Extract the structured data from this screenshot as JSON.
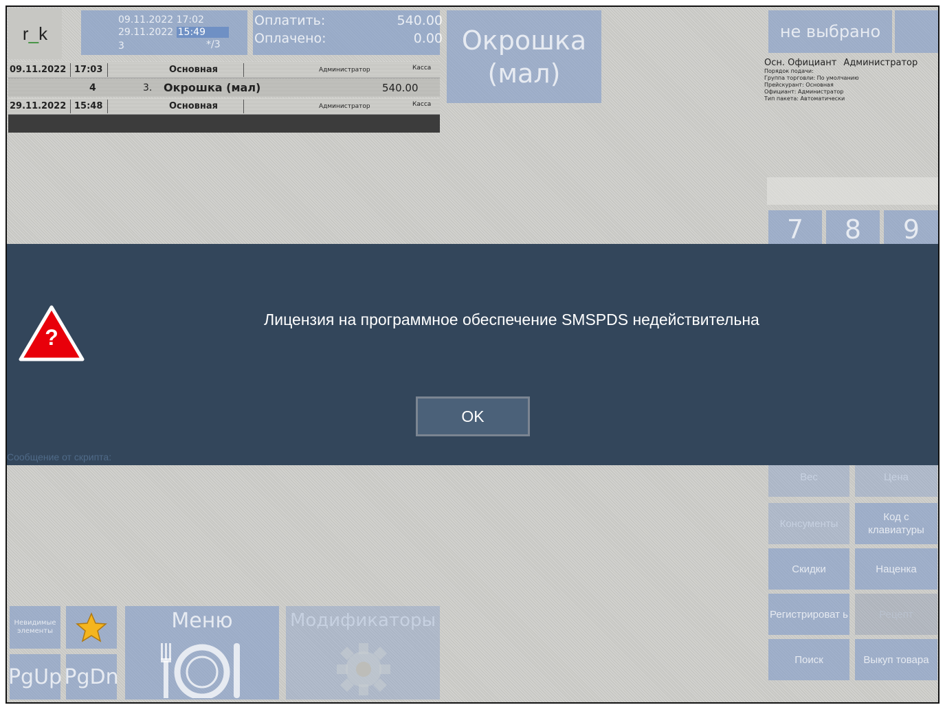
{
  "logo": {
    "text_a": "r",
    "text_b": "_",
    "text_c": "k"
  },
  "dates": {
    "date1": "09.11.2022 17:02",
    "date2_day": "29.11.2022",
    "date2_time": "15:49",
    "guests": "3",
    "table": "*/3"
  },
  "payment": {
    "to_pay_label": "Оплатить:",
    "to_pay_value": "540.00",
    "paid_label": "Оплачено:",
    "paid_value": "0.00"
  },
  "order": {
    "header1": {
      "date": "09.11.2022",
      "time": "17:03",
      "category": "Основная",
      "waiter": "Администратор",
      "station": "Касса"
    },
    "item": {
      "qty": "4",
      "num": "3.",
      "name": "Окрошка (мал)",
      "price": "540.00"
    },
    "header2": {
      "date": "29.11.2022",
      "time": "15:48",
      "category": "Основная",
      "waiter": "Администратор",
      "station": "Касса"
    }
  },
  "dish_tile": {
    "line1": "Окрошка",
    "line2": "(мал)"
  },
  "right_panel": {
    "waiter_button": "не выбрано",
    "main_waiter_label": "Осн. Официант",
    "main_waiter_value": "Администратор",
    "info_lines": [
      "Порядок подачи:",
      "Группа торговли: По умолчанию",
      "Прейскурант: Основная",
      "Официант: Администратор",
      "Тип пакета: Автоматически"
    ],
    "numpad": [
      "7",
      "8",
      "9"
    ]
  },
  "modal": {
    "message": "Лицензия на программное обеспечение SMSPDS недействительна",
    "ok_label": "OK",
    "icon_glyph": "?",
    "script_label": "Сообщение от скрипта:"
  },
  "functions": {
    "weight": "Вес",
    "price": "Цена",
    "consumables": "Консументы",
    "keyboard_code": "Код с клавиатуры",
    "discounts": "Скидки",
    "markup": "Наценка",
    "register": "Регистрироват ь",
    "recipe": "Рецепт",
    "search": "Поиск",
    "buyback": "Выкуп товара"
  },
  "bottom": {
    "invisible_elements": "Невидимые элементы",
    "pgup": "PgUp",
    "pgdn": "PgDn",
    "menu": "Меню",
    "modifiers": "Модификаторы"
  },
  "colors": {
    "modal_bg": "#33465b",
    "ok_button": "#4b6179",
    "warning_red": "#e8000a",
    "tile_blue": "#7896c8"
  }
}
